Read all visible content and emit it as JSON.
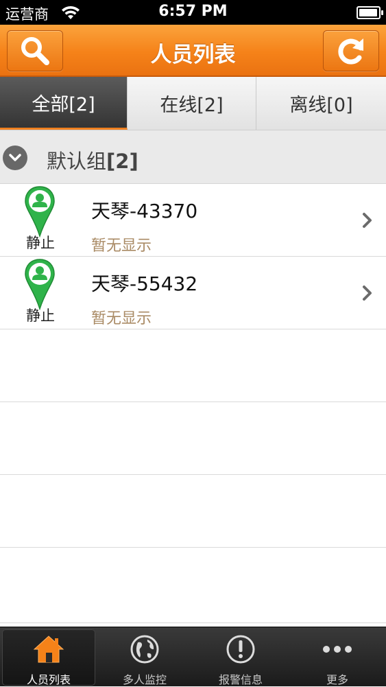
{
  "status_bar": {
    "carrier": "运营商",
    "time": "6:57 PM"
  },
  "navbar": {
    "title": "人员列表",
    "left_icon": "search-icon",
    "right_icon": "refresh-icon"
  },
  "tabs": [
    {
      "label": "全部[2]",
      "active": true
    },
    {
      "label": "在线[2]",
      "active": false
    },
    {
      "label": "离线[0]",
      "active": false
    }
  ],
  "group": {
    "name": "默认组",
    "count": "[2]"
  },
  "people": [
    {
      "name": "天琴-43370",
      "state": "静止",
      "desc": "暂无显示"
    },
    {
      "name": "天琴-55432",
      "state": "静止",
      "desc": "暂无显示"
    }
  ],
  "tabbar": [
    {
      "label": "人员列表",
      "icon": "home-icon",
      "active": true
    },
    {
      "label": "多人监控",
      "icon": "globe-icon",
      "active": false
    },
    {
      "label": "报警信息",
      "icon": "alert-icon",
      "active": false
    },
    {
      "label": "更多",
      "icon": "more-icon",
      "active": false
    }
  ],
  "colors": {
    "accent": "#f58219",
    "pin_green": "#2fb34a",
    "desc_text": "#a98a64"
  }
}
